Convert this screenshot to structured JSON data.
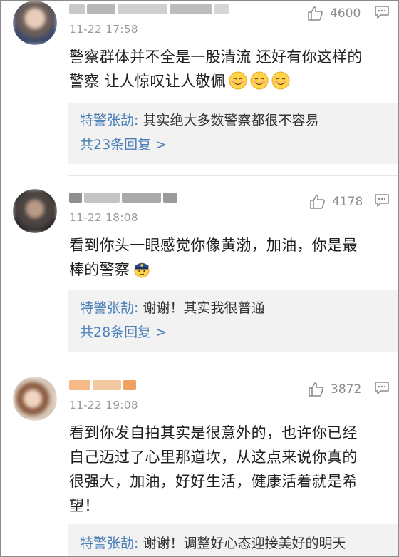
{
  "comments": [
    {
      "time": "11-22 17:58",
      "likes": "4600",
      "text_line1": "警察群体并不全是一股清流 还好有你这样的",
      "text_line2": "警察 让人惊叹让人敬佩",
      "emoji": [
        "smiling-face-icon",
        "smiling-face-icon",
        "smiling-face-icon"
      ],
      "reply": {
        "author": "特警张劼:",
        "text": " 其实绝大多数警察都很不容易",
        "more": "共23条回复 >"
      }
    },
    {
      "time": "11-22 18:08",
      "likes": "4178",
      "text_line1": "看到你头一眼感觉你像黄渤，加油，你是最",
      "text_line2": "棒的警察",
      "emoji": [
        "police-officer-icon"
      ],
      "reply": {
        "author": "特警张劼:",
        "text": " 谢谢！其实我很普通",
        "more": "共28条回复 >"
      }
    },
    {
      "time": "11-22 19:08",
      "likes": "3872",
      "text_line1": "看到你发自拍其实是很意外的，也许你已经",
      "text_line2": "自己迈过了心里那道坎，从这点来说你真的",
      "text_line3": "很强大，加油，好好生活，健康活着就是希",
      "text_line4": "望！",
      "reply": {
        "author": "特警张劼:",
        "text": " 谢谢！调整好心态迎接美好的明天"
      }
    }
  ],
  "colors": {
    "link": "#4a7fb8",
    "reply_bg": "#f2f2f2",
    "meta": "#9a9a9a"
  }
}
